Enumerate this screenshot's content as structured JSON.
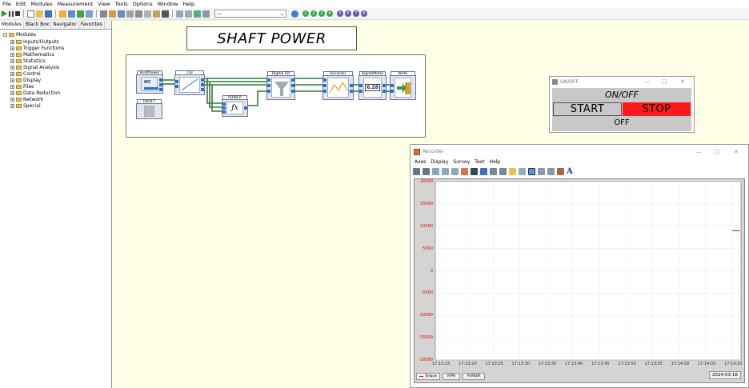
{
  "menu": [
    "File",
    "Edit",
    "Modules",
    "Measurement",
    "View",
    "Tools",
    "Options",
    "Window",
    "Help"
  ],
  "toolbar": {
    "combo_value": "—",
    "circle_numbers": [
      "1",
      "2",
      "3",
      "4",
      "5",
      "6",
      "7",
      "8"
    ],
    "circle_colors": [
      "#3aa84a",
      "#3aa84a",
      "#3aa84a",
      "#3aa84a",
      "#6a4fb0",
      "#6a4fb0",
      "#6a4fb0",
      "#6a4fb0"
    ]
  },
  "left_tabs": [
    "Modules",
    "Black Box",
    "Navigator",
    "Favorites"
  ],
  "tree": {
    "root": "Modules",
    "children": [
      "Inputs/Outputs",
      "Trigger Functions",
      "Mathematics",
      "Statistics",
      "Signal Analysis",
      "Control",
      "Display",
      "Files",
      "Data Reduction",
      "Network",
      "Special"
    ]
  },
  "worksheet": {
    "title": "SHAFT POWER",
    "modules": {
      "shaftpower": "ShaftPower",
      "cal": "Cal",
      "digital": "Digital Filt",
      "recorder": "Recorder",
      "digitalmeter": "DigitalMeter",
      "meter_value": "6.28",
      "write": "Write",
      "power": "POWER",
      "onoff": "ONOFF"
    }
  },
  "onoff_window": {
    "title": "ON/OFF",
    "heading": "ON/OFF",
    "start_label": "START",
    "stop_label": "STOP",
    "status": "OFF"
  },
  "recorder_window": {
    "title": "Recorder",
    "menu": [
      "Axes",
      "Display",
      "Survey",
      "Text",
      "Help"
    ],
    "date": "2024-03-16",
    "legend": [
      "Torque",
      "RPM",
      "POWER"
    ]
  },
  "chart_data": {
    "type": "line",
    "y_ticks": [
      "20000",
      "15000",
      "10000",
      "5000",
      "0",
      "-5000",
      "-10000",
      "-15000",
      "-20000"
    ],
    "x_ticks": [
      "17:13:15",
      "17:13:20",
      "17:13:25",
      "17:13:30",
      "17:13:35",
      "17:13:40",
      "17:13:45",
      "17:13:50",
      "17:13:55",
      "17:14:00",
      "17:14:05",
      "17:14:10"
    ],
    "ylim": [
      -20000,
      20000
    ],
    "series": [
      {
        "name": "Torque",
        "color": "#e00000",
        "x": [
          "17:14:10",
          "17:14:13"
        ],
        "values": [
          9000,
          9000
        ]
      }
    ],
    "grid": true
  }
}
